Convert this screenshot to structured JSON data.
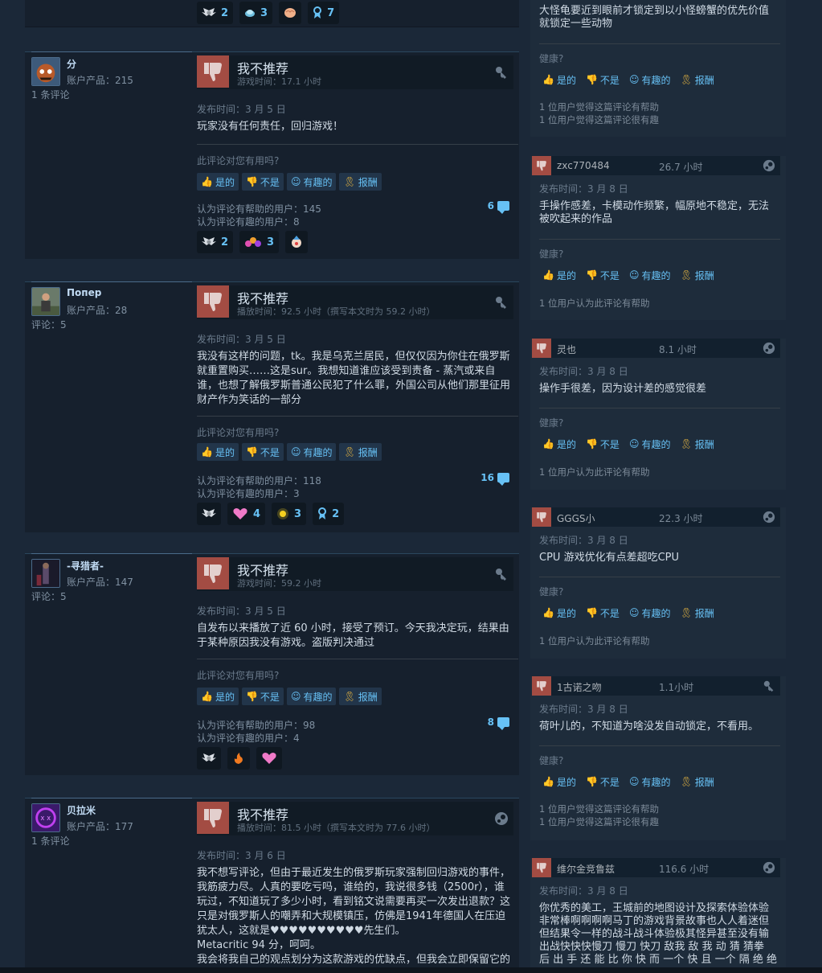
{
  "labels": {
    "verdict": "我不推荐",
    "helpful_q": "此评论对您有用吗?",
    "yes": "是的",
    "no": "不是",
    "funny": "有趣的",
    "award": "报酬",
    "healthy_q": "健康?"
  },
  "top_awards": [
    {
      "icon": "winged-award",
      "count": "2"
    },
    {
      "icon": "planet-award",
      "count": "3"
    },
    {
      "icon": "brain-award",
      "count": ""
    },
    {
      "icon": "ribbon-award",
      "count": "7"
    }
  ],
  "reviews": [
    {
      "username": "分",
      "products": "账户产品：215",
      "review_count": "1 条评论",
      "hours": "游戏时间：17.1 小时",
      "posted": "发布时间：3 月 5 日",
      "text": "玩家没有任何责任，回归游戏！",
      "helpful": "认为评论有帮助的用户：145",
      "funny": "认为评论有趣的用户：8",
      "comments": "6",
      "awards": [
        {
          "icon": "winged-award",
          "count": "2"
        },
        {
          "icon": "heart-bunch-award",
          "count": "3"
        },
        {
          "icon": "clown-award",
          "count": ""
        }
      ]
    },
    {
      "username": "Попер",
      "products": "账户产品：28",
      "review_count": "评论：5",
      "hours": "播放时间：92.5 小时（撰写本文时为 59.2 小时）",
      "posted": "发布时间：3 月 5 日",
      "text": "我没有这样的问题，tk。我是乌克兰居民，但仅仅因为你住在俄罗斯就重置购买……这是sur。我想知道谁应该受到责备 - 蒸汽或来自谁，也想了解俄罗斯普通公民犯了什么罪，外国公司从他们那里征用财产作为笑话的一部分",
      "helpful": "认为评论有帮助的用户：118",
      "funny": "认为评论有趣的用户：3",
      "comments": "16",
      "awards": [
        {
          "icon": "winged-award",
          "count": ""
        },
        {
          "icon": "pink-heart-award",
          "count": "4"
        },
        {
          "icon": "sun-award",
          "count": "3"
        },
        {
          "icon": "ribbon-award",
          "count": "2"
        }
      ]
    },
    {
      "username": "-寻猎者-",
      "products": "账户产品：147",
      "review_count": "评论：5",
      "hours": "游戏时间：59.2 小时",
      "posted": "发布时间：3 月 5 日",
      "text": "自发布以来播放了近 60 小时，接受了预订。今天我决定玩，结果由于某种原因我没有游戏。盗版判决通过",
      "helpful": "认为评论有帮助的用户：98",
      "funny": "认为评论有趣的用户：4",
      "comments": "8",
      "awards": [
        {
          "icon": "winged-award",
          "count": ""
        },
        {
          "icon": "fire-award",
          "count": ""
        },
        {
          "icon": "pink-heart-award",
          "count": ""
        }
      ]
    },
    {
      "username": "贝拉米",
      "products": "账户产品：177",
      "review_count": "1 条评论",
      "hours": "播放时间：81.5 小时（撰写本文时为 77.6 小时）",
      "posted": "发布时间：3 月 6 日",
      "text_lines": [
        "我不想写评论，但由于最近发生的俄罗斯玩家强制回归游戏的事件，我筋疲力尽。人真的要吃亏吗，谁给的，我说很多钱（2500r），谁玩过，不知道玩了多少小时，看到铭文说需要再买一次发出退款？这只是对俄罗斯人的嘲弄和大规模镇压，仿佛是1941年德国人在压迫犹太人，这就是♥♥♥♥♥♥♥♥♥♥先生们。",
        "Metacritic 94 分，呵呵。",
        "我会将我自己的观点划分为这款游戏的优缺点，但我会立即保留它的优缺点是相互关联的，对于它的每一个优点，都会有一个巨大的负面"
      ]
    }
  ],
  "right_top": {
    "text": "大怪龟要近到眼前才锁定到以小怪螃蟹的优先价值就锁定一些动物",
    "stat1": "1 位用户觉得这篇评论有帮助",
    "stat2": "1 位用户觉得这篇评论很有趣"
  },
  "right_reviews": [
    {
      "name": "zxc770484",
      "hours": "26.7 小时",
      "posted": "发布时间：3 月 8 日",
      "text": "手操作感差，卡模动作频繁，幅原地不稳定，无法被吹起来的作品",
      "stat1": "1 位用户认为此评论有帮助",
      "stat2": ""
    },
    {
      "name": "灵也",
      "hours": "8.1 小时",
      "posted": "发布时间：3 月 8 日",
      "text": "操作手很差，因为设计差的感觉很差",
      "stat1": "1 位用户认为此评论有帮助",
      "stat2": ""
    },
    {
      "name": "GGGS小",
      "hours": "22.3 小时",
      "posted": "发布时间：3 月 8 日",
      "text": "CPU 游戏优化有点差超吃CPU",
      "stat1": "1 位用户认为此评论有帮助",
      "stat2": ""
    },
    {
      "name": "1古诺之吻",
      "hours": "1.1小时",
      "posted": "发布时间：3 月 8 日",
      "text": "荷叶儿的，不知道为啥没发自动锁定，不看用。",
      "stat1": "1 位用户觉得这篇评论有帮助",
      "stat2": "1 位用户觉得这篇评论很有趣"
    },
    {
      "name": "维尔金竞鲁兹",
      "hours": "116.6 小时",
      "posted": "发布时间：3 月 8 日",
      "text": "你优秀的美工，王城前的地图设计及探索体验体验非常棒啊啊啊啊马丁的游戏背景故事也人人着迷但但结果令一样的战斗战斗体验极其怪异甚至没有输出战快快快慢刀 慢刀 快刀 敌我 敌 我 动 猜 猜拳 后 出 手 还 能 比 你 快 而 一个 快 且 一个 隔 绝 绝"
    }
  ]
}
